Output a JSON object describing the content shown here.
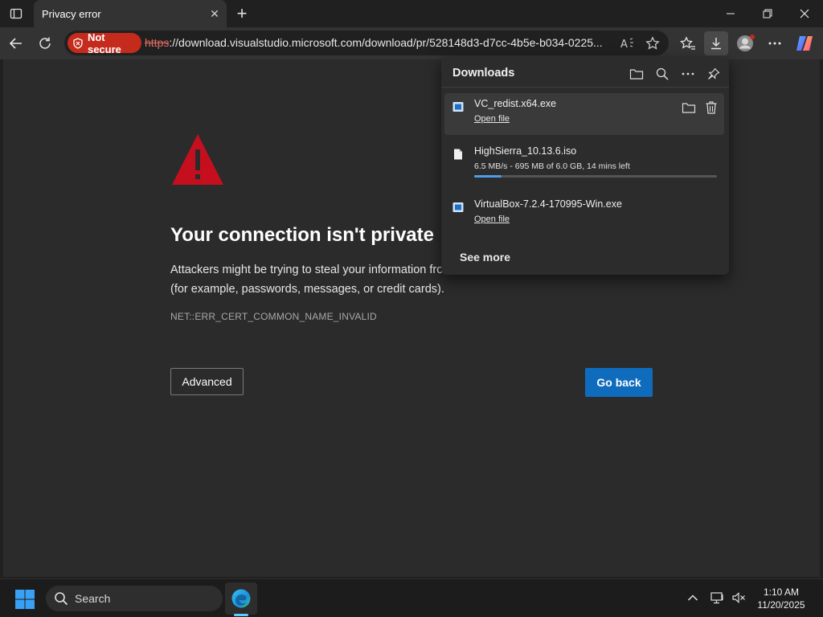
{
  "browser": {
    "tab_title": "Privacy error",
    "address_bar": {
      "security_label": "Not secure",
      "url_scheme": "https",
      "url_rest": "://download.visualstudio.microsoft.com/download/pr/528148d3-d7cc-4b5e-b034-0225..."
    }
  },
  "page": {
    "heading": "Your connection isn't private",
    "description": "Attackers might be trying to steal your information fro... (for example, passwords, messages, or credit cards).",
    "description_line1": "Attackers might be trying to steal your information fro",
    "description_line2": "(for example, passwords, messages, or credit cards).",
    "error_code": "NET::ERR_CERT_COMMON_NAME_INVALID",
    "advanced_label": "Advanced",
    "go_back_label": "Go back"
  },
  "downloads": {
    "title": "Downloads",
    "items": [
      {
        "name": "VC_redist.x64.exe",
        "action": "Open file"
      },
      {
        "name": "HighSierra_10.13.6.iso",
        "status": "6.5 MB/s - 695 MB of 6.0 GB, 14 mins left",
        "progress": 0.1131
      },
      {
        "name": "VirtualBox-7.2.4-170995-Win.exe",
        "action": "Open file"
      }
    ],
    "see_more": "See more"
  },
  "taskbar": {
    "search_label": "Search",
    "time": "1:10 AM",
    "date": "11/20/2025"
  },
  "colors": {
    "not_secure": "#c42b1c",
    "primary_button": "#0f6cbd",
    "warning_red": "#c50f1f",
    "progress": "#4c9fe8"
  }
}
